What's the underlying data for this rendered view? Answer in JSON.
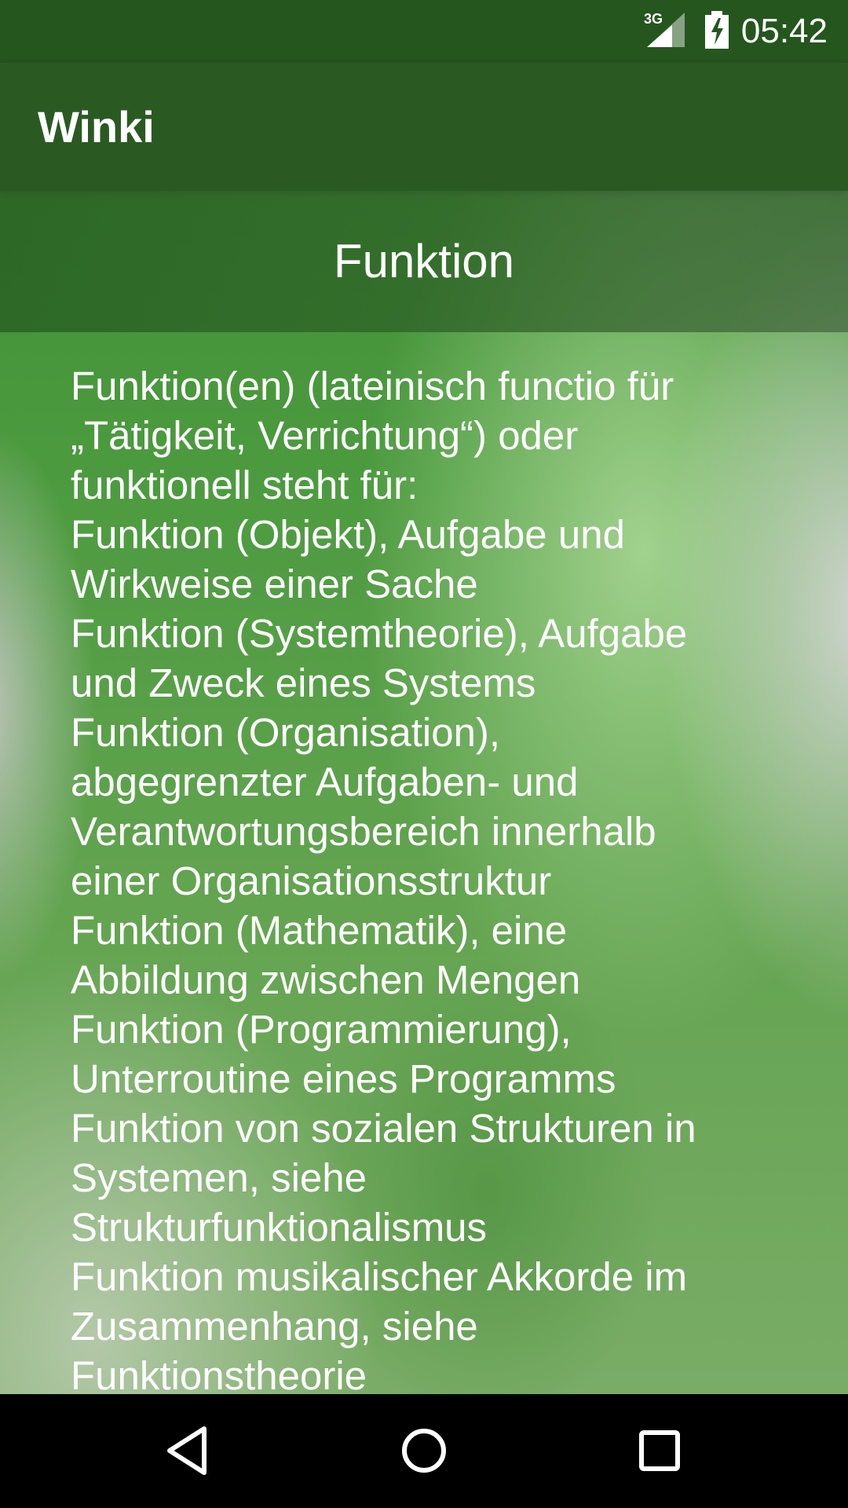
{
  "status_bar": {
    "network_label": "3G",
    "time": "05:42"
  },
  "toolbar": {
    "app_title": "Winki"
  },
  "header": {
    "title": "Funktion"
  },
  "article": {
    "lines": [
      "Funktion(en) (lateinisch functio für",
      "„Tätigkeit, Verrichtung“) oder",
      "funktionell steht für:",
      "Funktion (Objekt), Aufgabe und",
      "Wirkweise einer Sache",
      "Funktion (Systemtheorie), Aufgabe",
      "und Zweck eines Systems",
      "Funktion (Organisation),",
      "abgegrenzter Aufgaben- und",
      "Verantwortungsbereich innerhalb",
      "einer Organisationsstruktur",
      "Funktion (Mathematik), eine",
      "Abbildung zwischen Mengen",
      "Funktion (Programmierung),",
      "Unterroutine eines Programms",
      "Funktion von sozialen Strukturen in",
      "Systemen, siehe",
      "Strukturfunktionalismus",
      "Funktion musikalischer Akkorde im",
      "Zusammenhang, siehe",
      "Funktionstheorie"
    ]
  },
  "nav_bar": {
    "back_icon": "back-triangle-icon",
    "home_icon": "home-circle-icon",
    "recents_icon": "recents-square-icon"
  },
  "colors": {
    "status_bar": "#25561e",
    "toolbar": "#2a5a22",
    "text": "#ffffff",
    "nav_bar": "#000000"
  }
}
